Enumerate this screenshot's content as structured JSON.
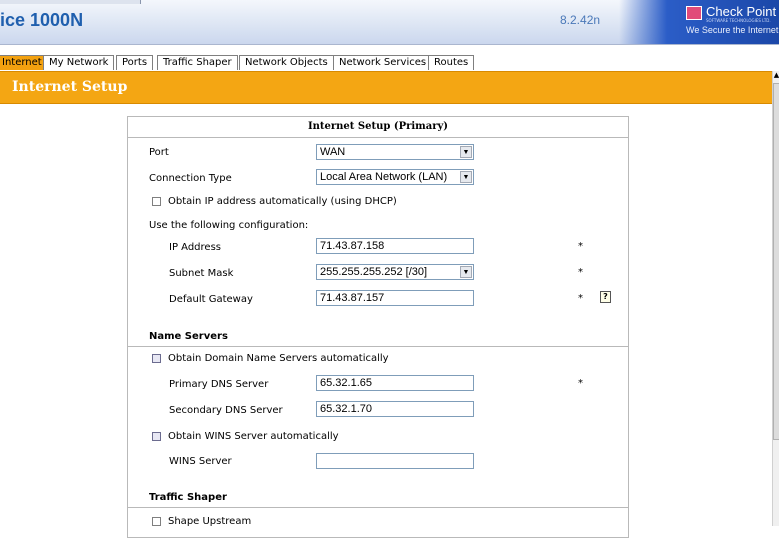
{
  "header": {
    "title": "ice 1000N",
    "version": "8.2.42n",
    "brand_name": "Check Point",
    "brand_sub": "SOFTWARE TECHNOLOGIES LTD.",
    "brand_tagline": "We Secure the Internet"
  },
  "tabs": [
    {
      "label": "Internet",
      "active": true
    },
    {
      "label": "My Network",
      "active": false
    },
    {
      "label": "Ports",
      "active": false
    },
    {
      "label": "Traffic Shaper",
      "active": false
    },
    {
      "label": "Network Objects",
      "active": false
    },
    {
      "label": "Network Services",
      "active": false
    },
    {
      "label": "Routes",
      "active": false
    }
  ],
  "banner": {
    "title": "Internet Setup"
  },
  "form": {
    "heading": "Internet Setup (Primary)",
    "port": {
      "label": "Port",
      "value": "WAN"
    },
    "connection_type": {
      "label": "Connection Type",
      "value": "Local Area Network (LAN)"
    },
    "dhcp": {
      "label": "Obtain IP address automatically (using DHCP)",
      "checked": false
    },
    "use_config_label": "Use the following configuration:",
    "ip_address": {
      "label": "IP Address",
      "value": "71.43.87.158"
    },
    "subnet_mask": {
      "label": "Subnet Mask",
      "value": "255.255.255.252 [/30]"
    },
    "default_gateway": {
      "label": "Default Gateway",
      "value": "71.43.87.157"
    },
    "required_mark": "*",
    "help_glyph": "?"
  },
  "name_servers": {
    "title": "Name Servers",
    "auto_dns": {
      "label": "Obtain Domain Name Servers automatically",
      "checked": false
    },
    "primary_dns": {
      "label": "Primary DNS Server",
      "value": "65.32.1.65"
    },
    "secondary_dns": {
      "label": "Secondary DNS Server",
      "value": "65.32.1.70"
    },
    "auto_wins": {
      "label": "Obtain WINS Server automatically",
      "checked": false
    },
    "wins": {
      "label": "WINS Server",
      "value": ""
    }
  },
  "traffic_shaper": {
    "title": "Traffic Shaper",
    "shape_upstream": {
      "label": "Shape Upstream",
      "checked": false
    }
  },
  "colors": {
    "accent": "#f4a613",
    "title_blue": "#1f5fae",
    "brand_blue": "#1b47a8"
  }
}
